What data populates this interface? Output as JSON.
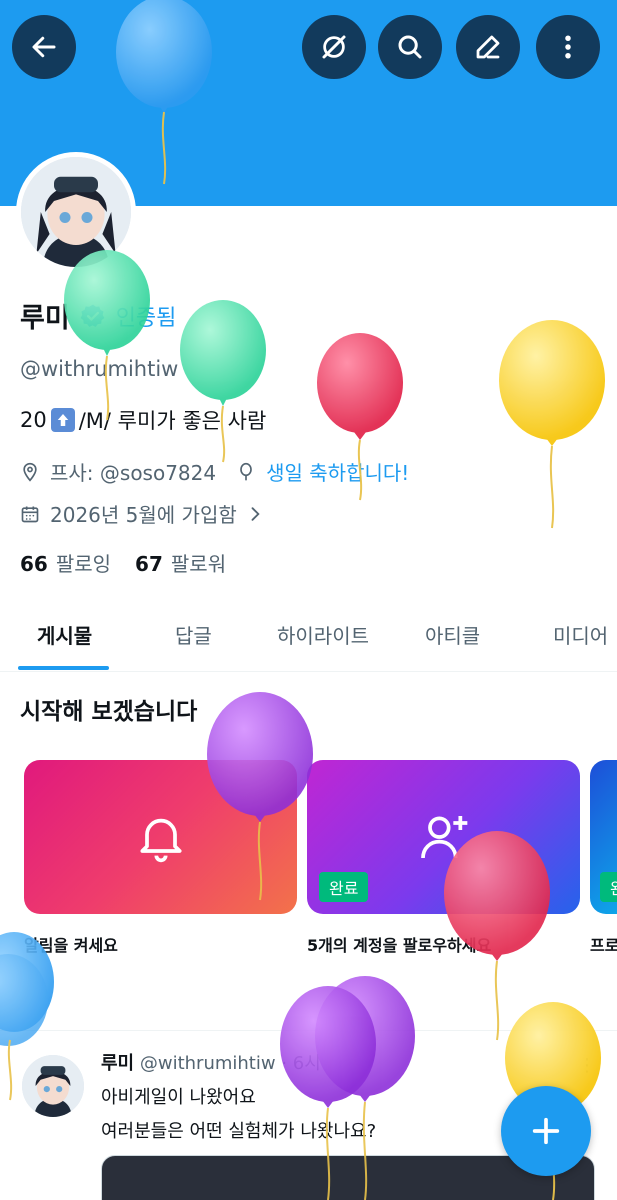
{
  "header": {
    "back_icon": "arrow-left-icon",
    "actions": [
      {
        "icon": "grok-icon"
      },
      {
        "icon": "search-icon"
      },
      {
        "icon": "edit-icon"
      },
      {
        "icon": "more-vertical-icon"
      }
    ],
    "banner_color": "#1d9bf0"
  },
  "profile": {
    "display_name": "루미",
    "verified_label": "인증됨",
    "handle": "@withrumihtiw",
    "bio_prefix": "20",
    "bio_suffix": " /M/ 루미가 좋은 사람",
    "location": "프사: @soso7824",
    "birthday": "생일 축하합니다!",
    "joined": "2026년 5월에 가입함",
    "following_count": "66",
    "following_label": "팔로잉",
    "followers_count": "67",
    "followers_label": "팔로워"
  },
  "tabs": [
    {
      "label": "게시물",
      "active": true
    },
    {
      "label": "답글"
    },
    {
      "label": "하이라이트"
    },
    {
      "label": "아티클"
    },
    {
      "label": "미디어"
    }
  ],
  "getting_started": {
    "title": "시작해 보겠습니다",
    "cards": [
      {
        "label": "알림을 켜세요",
        "icon": "bell-icon"
      },
      {
        "label": "5개의 계정을 팔로우하세요",
        "icon": "add-user-icon",
        "badge": "완료"
      },
      {
        "label": "프로",
        "badge": "완"
      }
    ]
  },
  "post": {
    "author": "루미",
    "handle": "@withrumihtiw",
    "time": "· 6시",
    "line1": "아비게일이 나왔어요",
    "line2": "여러분들은 어떤 실험체가 나왔나요?",
    "more": "⋮"
  },
  "fab": {
    "icon": "plus-icon"
  },
  "colors": {
    "accent": "#1d9bf0",
    "header_button": "#123a5c",
    "badge_green": "#00ba7c",
    "balloon_blue": "#2d9bf0",
    "balloon_green": "#3ee0a8",
    "balloon_pink": "#ea3a62",
    "balloon_yellow": "#fcd31e",
    "balloon_purple": "#9b3ee0"
  }
}
